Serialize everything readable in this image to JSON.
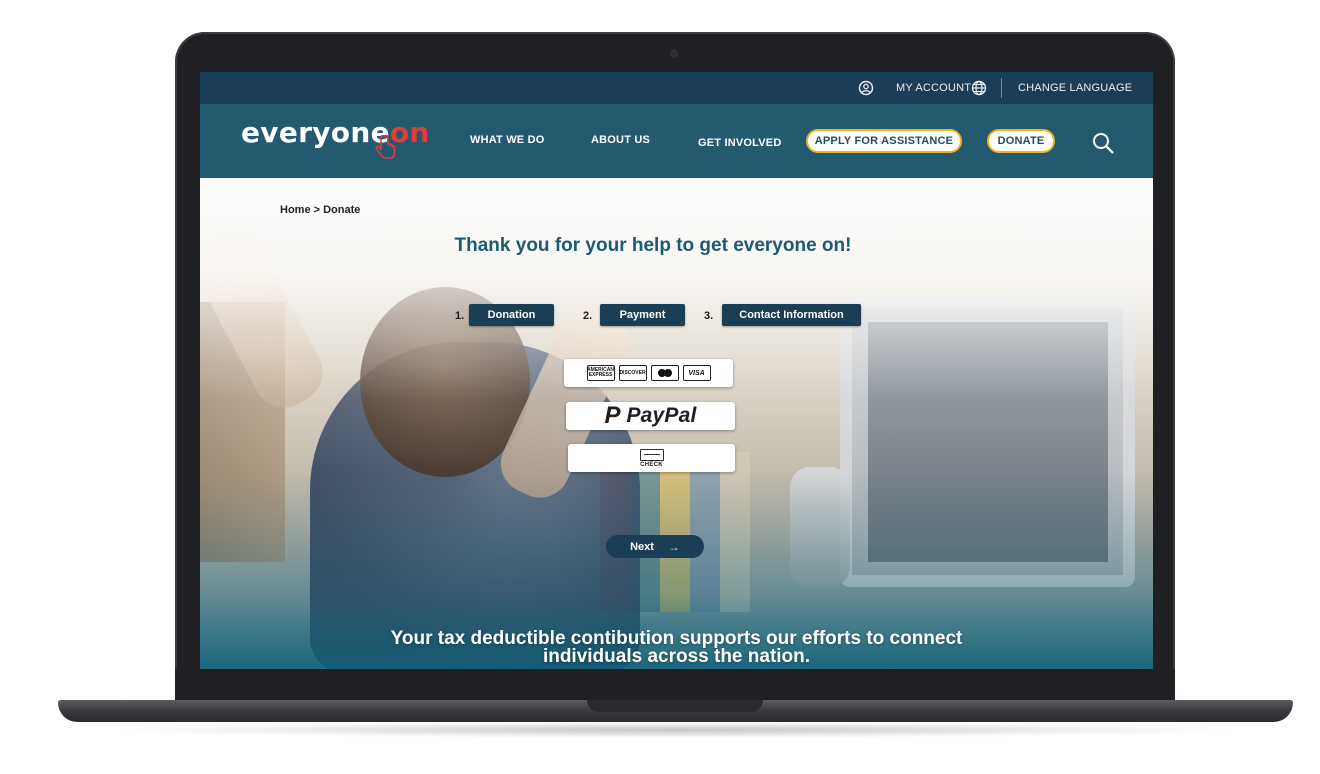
{
  "utility_bar": {
    "account_label": "MY ACCOUNT",
    "language_label": "CHANGE LANGUAGE"
  },
  "nav": {
    "logo_main": "everyone",
    "logo_accent": "on",
    "links": [
      "WHAT WE DO",
      "ABOUT US",
      "GET INVOLVED"
    ],
    "apply_label": "APPLY FOR ASSISTANCE",
    "donate_label": "DONATE"
  },
  "breadcrumb": "Home > Donate",
  "headline": "Thank you for your help to get everyone on!",
  "steps": [
    {
      "num": "1.",
      "label": "Donation"
    },
    {
      "num": "2.",
      "label": "Payment"
    },
    {
      "num": "3.",
      "label": "Contact Information"
    }
  ],
  "payment_options": {
    "cards": {
      "amex": "AMERICAN EXPRESS",
      "discover": "DISCOVER",
      "visa": "VISA"
    },
    "paypal": "PayPal",
    "check": "CHECK"
  },
  "next_label": "Next",
  "tagline": "Your tax deductible contibution supports our efforts to connect individuals across the nation.",
  "colors": {
    "navy": "#1a3e55",
    "teal_nav": "#245a70",
    "accent_red": "#e23b3b",
    "pill_border": "#f2b323",
    "headline": "#1d5a70"
  },
  "icons": [
    "account-icon",
    "globe-icon",
    "search-icon",
    "cursor-hand-icon",
    "arrow-right-icon",
    "paypal-p-icon",
    "check-icon",
    "card-icons"
  ]
}
